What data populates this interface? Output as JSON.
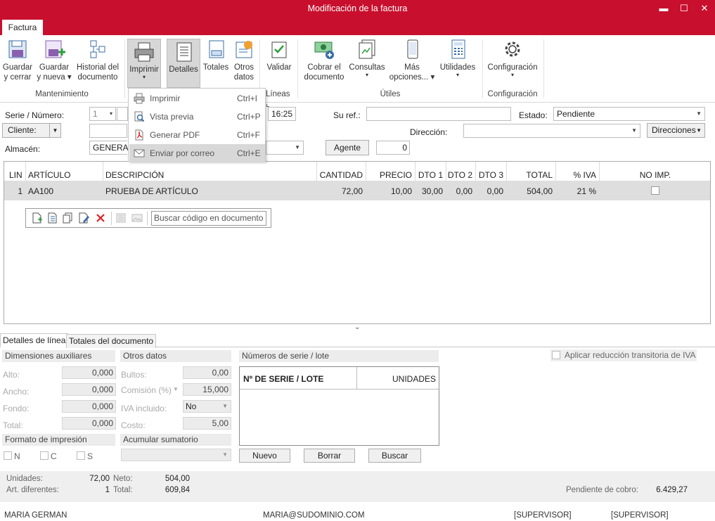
{
  "window": {
    "title": "Modificación de la factura"
  },
  "tabs": {
    "factura": "Factura"
  },
  "ribbon": {
    "guardar_cerrar": [
      "Guardar",
      "y cerrar"
    ],
    "guardar_nueva": [
      "Guardar",
      "y nueva"
    ],
    "historial": [
      "Historial del",
      "documento"
    ],
    "imprimir": "Imprimir",
    "detalles": "Detalles",
    "totales": "Totales",
    "otros_datos": [
      "Otros",
      "datos"
    ],
    "validar": "Validar",
    "cobrar": [
      "Cobrar el",
      "documento"
    ],
    "consultas": "Consultas",
    "mas_opciones": [
      "Más",
      "opciones..."
    ],
    "utilidades": "Utilidades",
    "configuracion": "Configuración",
    "group_mantenimiento": "Mantenimiento",
    "group_lineas": "Líneas",
    "group_utiles": "Útiles",
    "group_configuracion": "Configuración"
  },
  "print_menu": [
    {
      "label": "Imprimir",
      "shortcut": "Ctrl+I",
      "icon": "printer-icon"
    },
    {
      "label": "Vista previa",
      "shortcut": "Ctrl+P",
      "icon": "preview-icon"
    },
    {
      "label": "Generar PDF",
      "shortcut": "Ctrl+F",
      "icon": "pdf-icon"
    },
    {
      "label": "Enviar por correo",
      "shortcut": "Ctrl+E",
      "icon": "mail-icon"
    }
  ],
  "form": {
    "serie_label": "Serie / Número:",
    "serie_value": "1",
    "time_value": "16:25",
    "su_ref_label": "Su ref.:",
    "su_ref_value": "",
    "estado_label": "Estado:",
    "estado_value": "Pendiente",
    "cliente_label": "Cliente:",
    "direccion_label": "Dirección:",
    "direccion_value": "",
    "direcciones_button": "Direcciones",
    "almacen_label": "Almacén:",
    "almacen_value": "GENERAL",
    "agente_button": "Agente",
    "agente_value": "0"
  },
  "grid": {
    "headers": [
      "LIN",
      "ARTÍCULO",
      "DESCRIPCIÓN",
      "CANTIDAD",
      "PRECIO",
      "DTO 1",
      "DTO 2",
      "DTO 3",
      "TOTAL",
      "% IVA",
      "NO IMP."
    ],
    "rows": [
      {
        "lin": "1",
        "articulo": "AA100",
        "descripcion": "PRUEBA DE ARTÍCULO",
        "cantidad": "72,00",
        "precio": "10,00",
        "dto1": "30,00",
        "dto2": "0,00",
        "dto3": "0,00",
        "total": "504,00",
        "iva": "21 %",
        "no_imp": false
      }
    ],
    "search_placeholder": "Buscar código en documento"
  },
  "bottom_tabs": {
    "detalles": "Detalles de línea",
    "totales": "Totales del documento"
  },
  "details": {
    "dimensiones": "Dimensiones auxiliares",
    "alto_label": "Alto:",
    "alto": "0,000",
    "ancho_label": "Ancho:",
    "ancho": "0,000",
    "fondo_label": "Fondo:",
    "fondo": "0,000",
    "total_label": "Total:",
    "total": "0,000",
    "otros_datos": "Otros datos",
    "bultos_label": "Bultos:",
    "bultos": "0,00",
    "comision_label": "Comisión (%)",
    "comision": "15,000",
    "iva_incluido_label": "IVA incluido:",
    "iva_incluido": "No",
    "costo_label": "Costo:",
    "costo": "5,00",
    "formato_impresion": "Formato de impresión",
    "fmt_n": "N",
    "fmt_c": "C",
    "fmt_s": "S",
    "acumular": "Acumular sumatorio",
    "series_title": "Números de serie / lote",
    "series_col1": "Nº DE SERIE / LOTE",
    "series_col2": "UNIDADES",
    "nuevo": "Nuevo",
    "borrar": "Borrar",
    "buscar": "Buscar",
    "reduccion_iva": "Aplicar reducción transitoria de IVA"
  },
  "footer": {
    "unidades_label": "Unidades:",
    "unidades": "72,00",
    "art_dif_label": "Art. diferentes:",
    "art_dif": "1",
    "neto_label": "Neto:",
    "neto": "504,00",
    "total_label": "Total:",
    "total": "609,84",
    "pendiente_label": "Pendiente de cobro:",
    "pendiente": "6.429,27"
  },
  "status": {
    "user": "MARIA GERMAN",
    "email": "MARIA@SUDOMINIO.COM",
    "role1": "[SUPERVISOR]",
    "role2": "[SUPERVISOR]"
  },
  "colors": {
    "accent": "#c8102e",
    "selection": "#dedede"
  }
}
